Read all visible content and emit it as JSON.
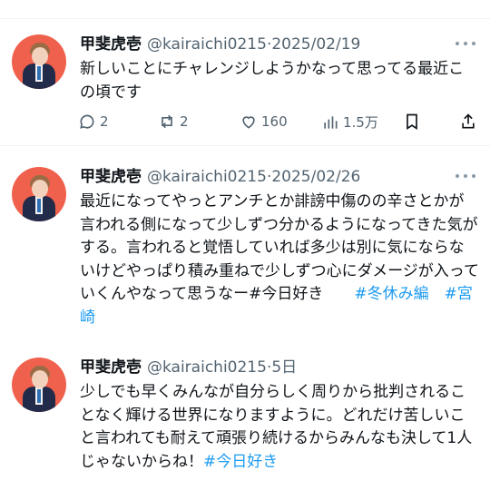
{
  "tweets": [
    {
      "name": "甲斐虎壱",
      "handle": "@kairaichi0215",
      "separator": "·",
      "date": "2025/02/19",
      "text": "新しいことにチャレンジしようかなって思ってる最近この頃です",
      "hashtags": [],
      "stats": {
        "replies": "2",
        "reposts": "2",
        "likes": "160",
        "views": "1.5万"
      }
    },
    {
      "name": "甲斐虎壱",
      "handle": "@kairaichi0215",
      "separator": "·",
      "date": "2025/02/26",
      "text": "最近になってやっとアンチとか誹謗中傷のの辛さとかが言われる側になって少しずつ分かるようになってきた気がする。言われると覚悟していれば多少は別に気にならないけどやっぱり積み重ねで少しずつ心にダメージが入っていくんやなって思うなー#今日好き",
      "hashtags": [
        "#冬休み編",
        "#宮崎"
      ]
    },
    {
      "name": "甲斐虎壱",
      "handle": "@kairaichi0215",
      "separator": "·",
      "date": "5日",
      "text": "少しでも早くみんなが自分らしく周りから批判されることなく輝ける世界になりますように。どれだけ苦しいこと言われても耐えて頑張り続けるからみんなも決して1人じゃないからね！",
      "hashtags": [
        "#今日好き"
      ]
    }
  ],
  "icons": {
    "reply": "reply-icon",
    "repost": "repost-icon",
    "like": "heart-icon",
    "views": "views-icon",
    "bookmark": "bookmark-icon",
    "share": "share-icon",
    "more": "more-icon"
  },
  "colors": {
    "link": "#1d9bf0",
    "secondary": "#536471",
    "avatar_bg": "#f0614d"
  }
}
